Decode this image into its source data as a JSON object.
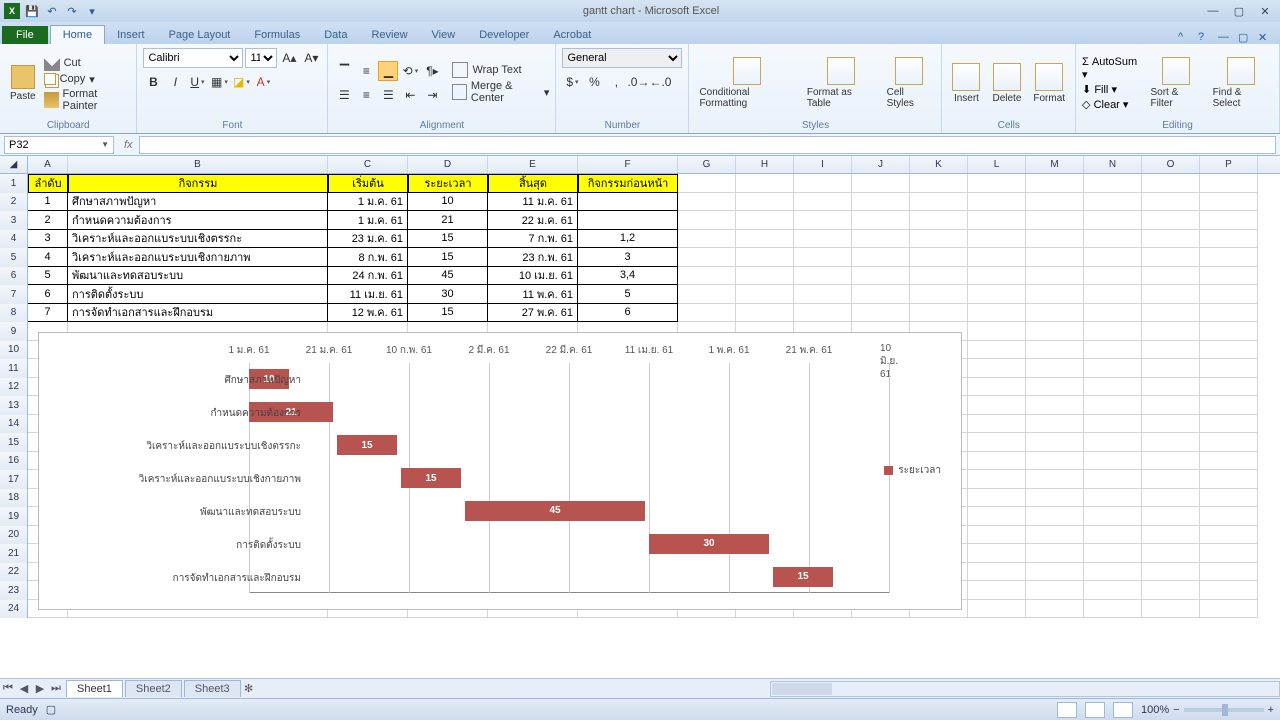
{
  "title": "gantt chart - Microsoft Excel",
  "tabs": {
    "file": "File",
    "home": "Home",
    "insert": "Insert",
    "pageLayout": "Page Layout",
    "formulas": "Formulas",
    "data": "Data",
    "review": "Review",
    "view": "View",
    "developer": "Developer",
    "acrobat": "Acrobat"
  },
  "ribbon": {
    "clipboard": {
      "label": "Clipboard",
      "paste": "Paste",
      "cut": "Cut",
      "copy": "Copy",
      "fmt": "Format Painter"
    },
    "font": {
      "label": "Font",
      "name": "Calibri",
      "size": "11"
    },
    "alignment": {
      "label": "Alignment",
      "wrap": "Wrap Text",
      "merge": "Merge & Center"
    },
    "number": {
      "label": "Number",
      "format": "General"
    },
    "styles": {
      "label": "Styles",
      "cond": "Conditional Formatting",
      "table": "Format as Table",
      "cell": "Cell Styles"
    },
    "cells": {
      "label": "Cells",
      "insert": "Insert",
      "delete": "Delete",
      "format": "Format"
    },
    "editing": {
      "label": "Editing",
      "autosum": "AutoSum",
      "fill": "Fill",
      "clear": "Clear",
      "sort": "Sort & Filter",
      "find": "Find & Select"
    }
  },
  "namebox": "P32",
  "columns": [
    "A",
    "B",
    "C",
    "D",
    "E",
    "F",
    "G",
    "H",
    "I",
    "J",
    "K",
    "L",
    "M",
    "N",
    "O",
    "P"
  ],
  "headers": {
    "A": "ลำดับ",
    "B": "กิจกรรม",
    "C": "เริ่มต้น",
    "D": "ระยะเวลา",
    "E": "สิ้นสุด",
    "F": "กิจกรรมก่อนหน้า"
  },
  "rows": [
    {
      "n": "1",
      "act": "ศึกษาสภาพปัญหา",
      "start": "1 ม.ค. 61",
      "dur": "10",
      "end": "11 ม.ค. 61",
      "pre": ""
    },
    {
      "n": "2",
      "act": "กำหนดความต้องการ",
      "start": "1 ม.ค. 61",
      "dur": "21",
      "end": "22 ม.ค. 61",
      "pre": ""
    },
    {
      "n": "3",
      "act": "วิเคราะห์และออกแบระบบเชิงตรรกะ",
      "start": "23 ม.ค. 61",
      "dur": "15",
      "end": "7 ก.พ. 61",
      "pre": "1,2"
    },
    {
      "n": "4",
      "act": "วิเคราะห์และออกแบระบบเชิงกายภาพ",
      "start": "8 ก.พ. 61",
      "dur": "15",
      "end": "23 ก.พ. 61",
      "pre": "3"
    },
    {
      "n": "5",
      "act": "พัฒนาและทดสอบระบบ",
      "start": "24 ก.พ. 61",
      "dur": "45",
      "end": "10 เม.ย. 61",
      "pre": "3,4"
    },
    {
      "n": "6",
      "act": "การติดตั้งระบบ",
      "start": "11 เม.ย. 61",
      "dur": "30",
      "end": "11 พ.ค. 61",
      "pre": "5"
    },
    {
      "n": "7",
      "act": "การจัดทำเอกสารและฝึกอบรม",
      "start": "12 พ.ค. 61",
      "dur": "15",
      "end": "27 พ.ค. 61",
      "pre": "6"
    }
  ],
  "chart_data": {
    "type": "bar",
    "orientation": "horizontal-stacked-gantt",
    "legend": "ระยะเวลา",
    "x_ticks": [
      "1 ม.ค. 61",
      "21 ม.ค. 61",
      "10 ก.พ. 61",
      "2 มี.ค. 61",
      "22 มี.ค. 61",
      "11 เม.ย. 61",
      "1 พ.ค. 61",
      "21 พ.ค. 61",
      "10 มิ.ย. 61"
    ],
    "x_tick_day": [
      0,
      20,
      40,
      60,
      80,
      100,
      120,
      140,
      160
    ],
    "series": [
      {
        "name": "ศึกษาสภาพปัญหา",
        "start_day": 0,
        "duration": 10
      },
      {
        "name": "กำหนดความต้องการ",
        "start_day": 0,
        "duration": 21
      },
      {
        "name": "วิเคราะห์และออกแบระบบเชิงตรรกะ",
        "start_day": 22,
        "duration": 15
      },
      {
        "name": "วิเคราะห์และออกแบระบบเชิงกายภาพ",
        "start_day": 38,
        "duration": 15
      },
      {
        "name": "พัฒนาและทดสอบระบบ",
        "start_day": 54,
        "duration": 45
      },
      {
        "name": "การติดตั้งระบบ",
        "start_day": 100,
        "duration": 30
      },
      {
        "name": "การจัดทำเอกสารและฝึกอบรม",
        "start_day": 131,
        "duration": 15
      }
    ]
  },
  "sheets": {
    "s1": "Sheet1",
    "s2": "Sheet2",
    "s3": "Sheet3"
  },
  "status": {
    "ready": "Ready",
    "zoom": "100%"
  }
}
